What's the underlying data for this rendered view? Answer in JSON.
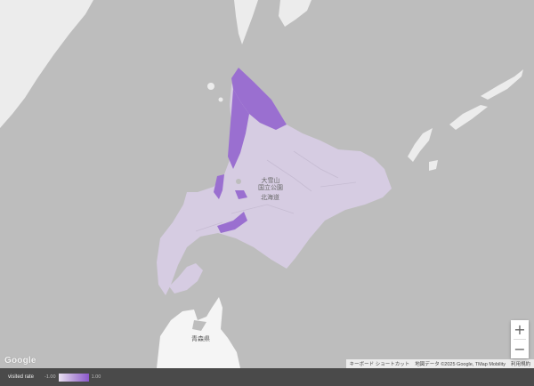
{
  "map": {
    "labels": {
      "ishikari_range": "大雪山\n国立公園",
      "hokkaido": "北海道",
      "aomori": "青森県"
    },
    "google_logo": "Google",
    "attribution": {
      "shortcuts": "キーボード ショートカット",
      "map_data": "地図データ ©2025 Google, TMap Mobility",
      "terms": "利用規約"
    },
    "zoom": {
      "in": "+",
      "out": "−"
    },
    "colors": {
      "background": "#bdbdbd",
      "land_base": "#d6cce2",
      "land_high": "#9a6fd0",
      "land_other": "#ececec",
      "legend_bar": "#4a4a4a"
    }
  },
  "legend": {
    "title": "visited rate",
    "min": "-1.00",
    "max": "1.00",
    "gradient_start": "#e9e0f2",
    "gradient_end": "#8b58cb"
  }
}
